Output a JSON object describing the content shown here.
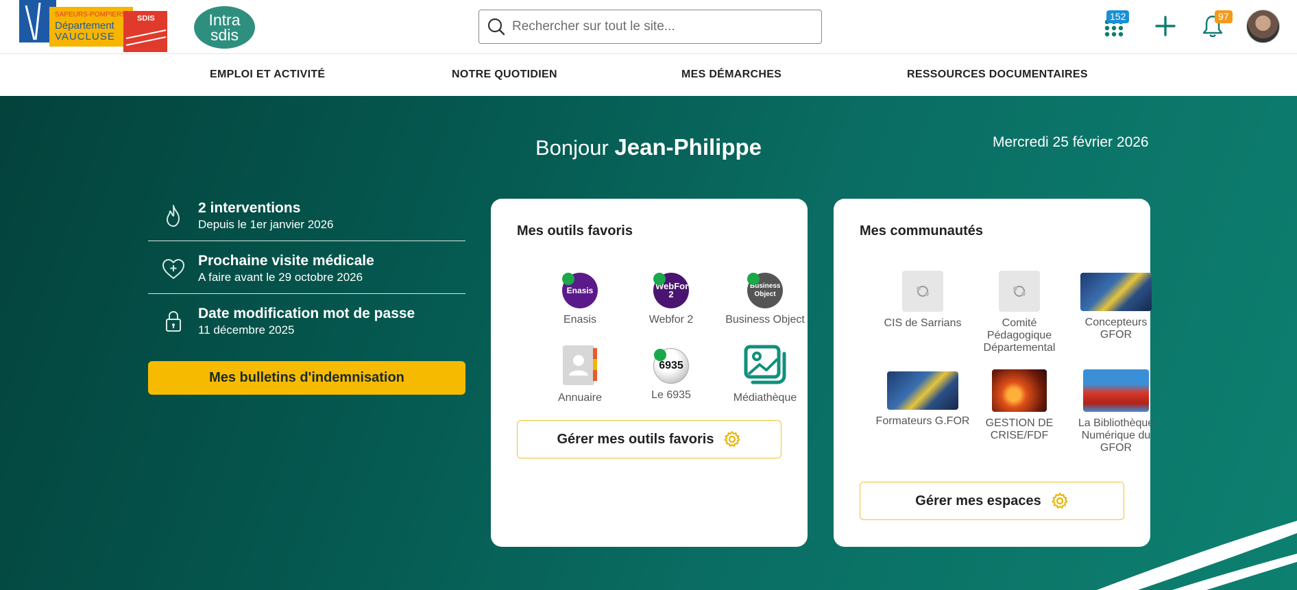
{
  "header": {
    "logo_sdis": {
      "lines": [
        "SAPEURS-POMPIERS",
        "Département",
        "VAUCLUSE"
      ],
      "tag": "SDIS"
    },
    "logo_intra": {
      "line1": "Intra",
      "line2": "sdis"
    },
    "search_placeholder": "Rechercher sur tout le site...",
    "apps_badge": "152",
    "notif_badge": "97",
    "icons": [
      "apps-grid-icon",
      "plus-icon",
      "bell-icon"
    ],
    "accent": "#0e7d6e"
  },
  "nav": {
    "items": [
      "EMPLOI ET ACTIVITÉ",
      "NOTRE QUOTIDIEN",
      "MES DÉMARCHES",
      "RESSOURCES DOCUMENTAIRES"
    ]
  },
  "hero": {
    "greeting": "Bonjour",
    "name": "Jean-Philippe",
    "date": "Mercredi 25 février 2026",
    "stats": [
      {
        "icon": "flame-icon",
        "title": "2 interventions",
        "subtitle": "Depuis le 1er janvier 2026"
      },
      {
        "icon": "heart-plus-icon",
        "title": "Prochaine visite médicale",
        "subtitle": "A faire avant le 29 octobre 2026"
      },
      {
        "icon": "lock-icon",
        "title": "Date modification mot de passe",
        "subtitle": "11 décembre 2025"
      }
    ],
    "bulletins_button": "Mes bulletins d'indemnisation"
  },
  "tools": {
    "title": "Mes outils favoris",
    "items": [
      {
        "label": "Enasis",
        "badge_text": "Enasis",
        "color": "#5a1a8a"
      },
      {
        "label": "Webfor 2",
        "badge_text": "WebFor 2",
        "color": "#4a1570"
      },
      {
        "label": "Business Object",
        "badge_text": "Business Object",
        "color": "#555555"
      },
      {
        "label": "Annuaire",
        "badge_text": "",
        "color": "#cfcfcf"
      },
      {
        "label": "Le 6935",
        "badge_text": "6935",
        "color": "#e0e0e0"
      },
      {
        "label": "Médiathèque",
        "badge_text": "",
        "color": "#12907c"
      }
    ],
    "manage_button": "Gérer mes outils favoris"
  },
  "communities": {
    "title": "Mes communautés",
    "items": [
      {
        "label": "CIS de Sarrians"
      },
      {
        "label": "Comité Pédagogique Départemental"
      },
      {
        "label": "Concepteurs GFOR"
      },
      {
        "label": "Formateurs G.FOR"
      },
      {
        "label": "GESTION DE CRISE/FDF"
      },
      {
        "label": "La Bibliothèque Numérique du GFOR"
      }
    ],
    "manage_button": "Gérer mes espaces"
  }
}
